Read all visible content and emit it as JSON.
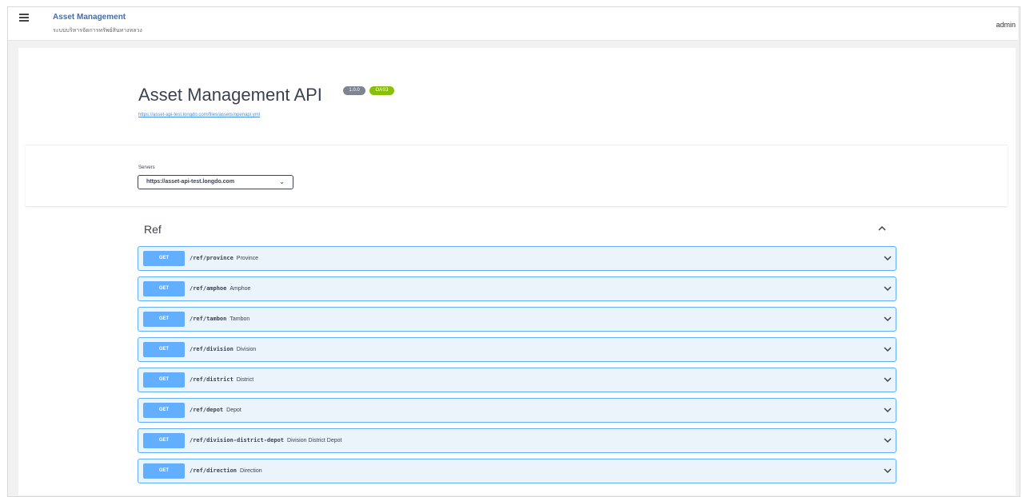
{
  "header": {
    "app_title": "Asset Management",
    "app_subtitle": "ระบบบริหารจัดการทรัพย์สินทางหลวง",
    "user": "admin"
  },
  "api": {
    "title": "Asset Management API",
    "version_badge": "1.0.0",
    "oas_badge": "OAS3",
    "spec_url": "https://asset-api-test.longdo.com/files/assets/openapi.yml"
  },
  "servers": {
    "label": "Servers",
    "selected": "https://asset-api-test.longdo.com"
  },
  "section": {
    "title": "Ref"
  },
  "operations": [
    {
      "method": "GET",
      "path": "/ref/province",
      "description": "Province"
    },
    {
      "method": "GET",
      "path": "/ref/amphoe",
      "description": "Amphoe"
    },
    {
      "method": "GET",
      "path": "/ref/tambon",
      "description": "Tambon"
    },
    {
      "method": "GET",
      "path": "/ref/division",
      "description": "Division"
    },
    {
      "method": "GET",
      "path": "/ref/district",
      "description": "District"
    },
    {
      "method": "GET",
      "path": "/ref/depot",
      "description": "Depot"
    },
    {
      "method": "GET",
      "path": "/ref/division-district-depot",
      "description": "Division District Depot"
    },
    {
      "method": "GET",
      "path": "/ref/direction",
      "description": "Direction"
    }
  ],
  "colors": {
    "get_method": "#61affe",
    "get_row_bg": "#ebf3fb",
    "oas_badge": "#89bf04",
    "version_badge": "#7d8492"
  }
}
